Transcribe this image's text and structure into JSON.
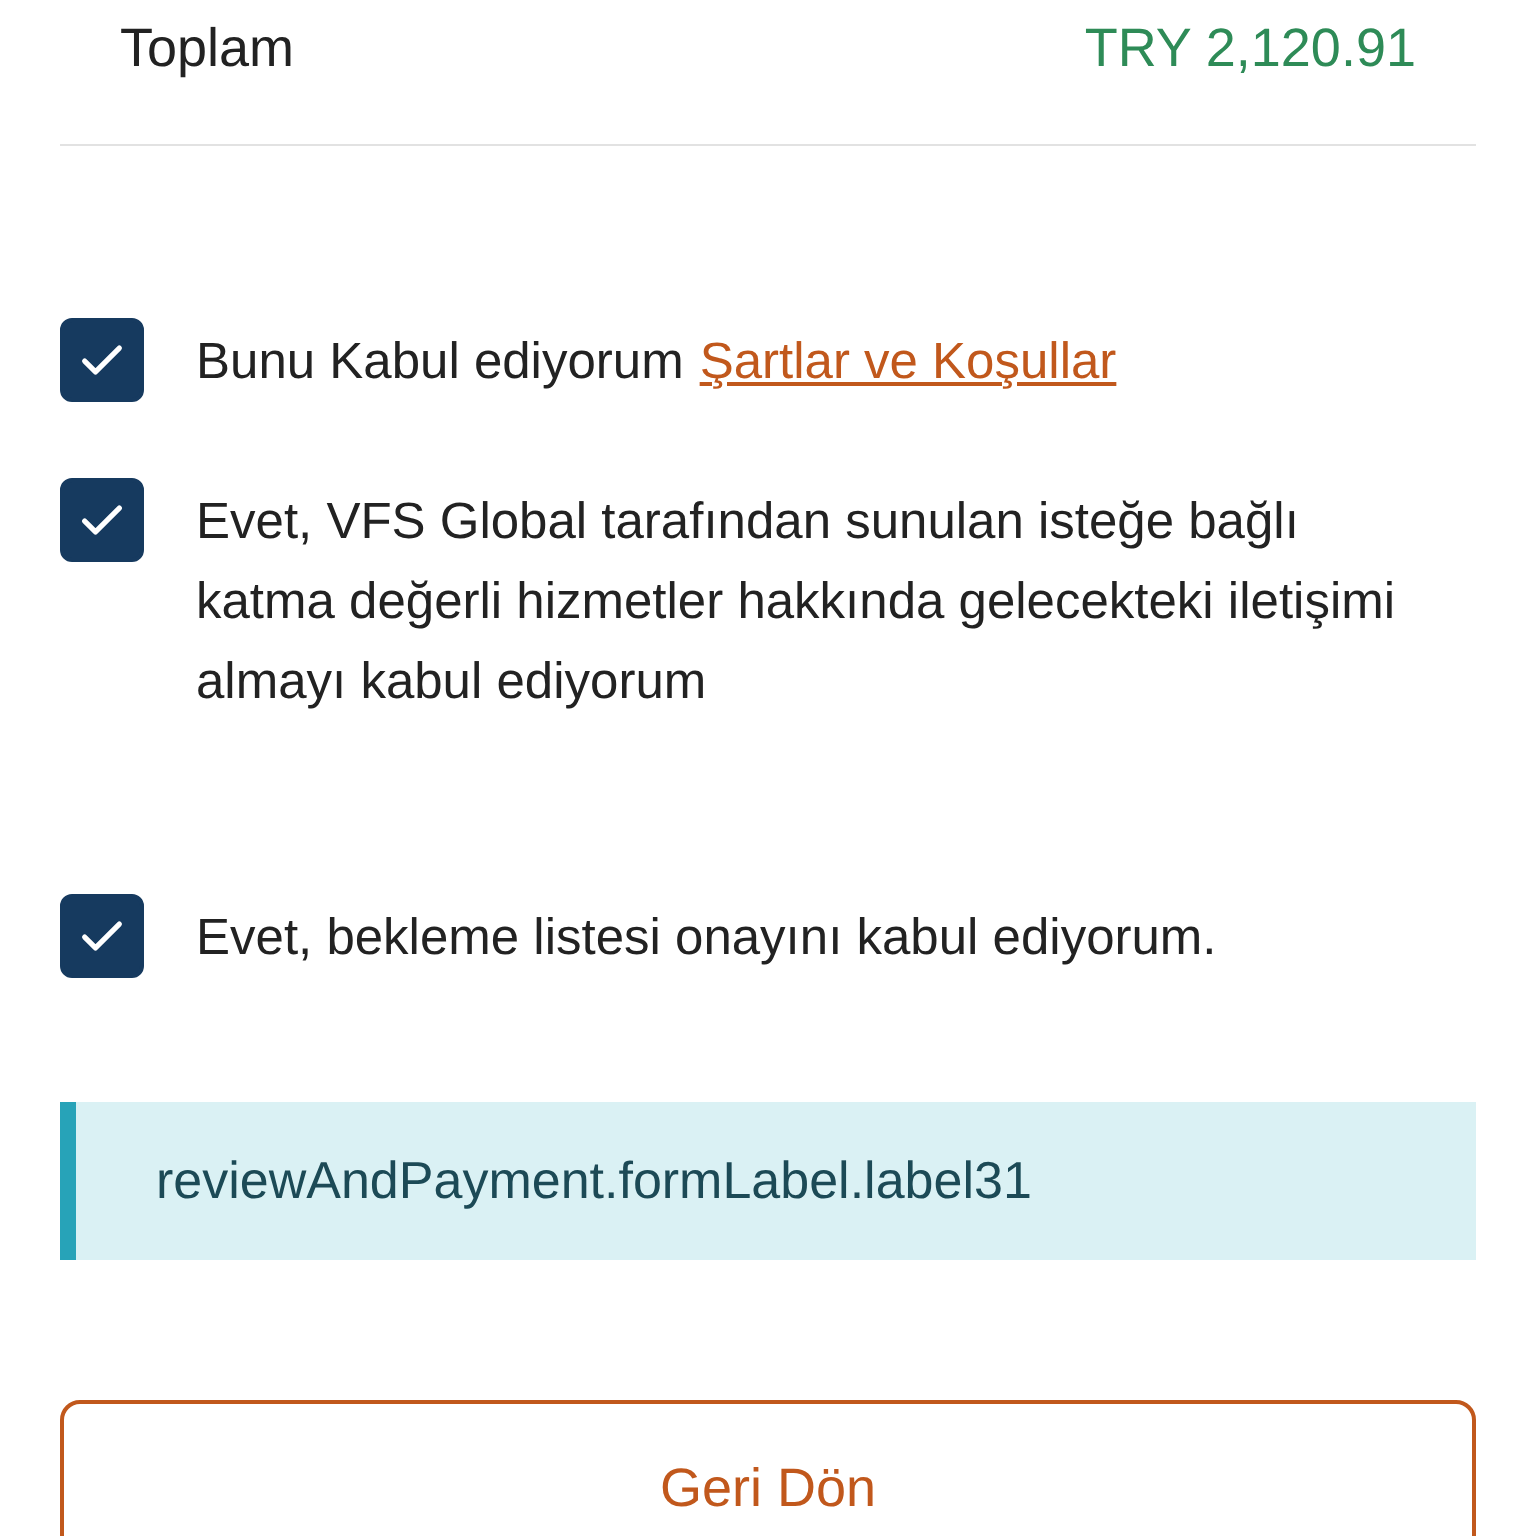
{
  "total": {
    "label": "Toplam",
    "amount": "TRY 2,120.91"
  },
  "consents": [
    {
      "text": "Bunu Kabul ediyorum",
      "link": "Şartlar ve Koşullar",
      "checked": true
    },
    {
      "text": "Evet, VFS Global tarafından sunulan isteğe bağlı katma değerli hizmetler hakkında gelecekteki iletişimi almayı kabul ediyorum",
      "checked": true
    },
    {
      "text": "Evet, bekleme listesi onayını kabul ediyorum.",
      "checked": true
    }
  ],
  "info_note": "reviewAndPayment.formLabel.label31",
  "back_button": "Geri Dön"
}
